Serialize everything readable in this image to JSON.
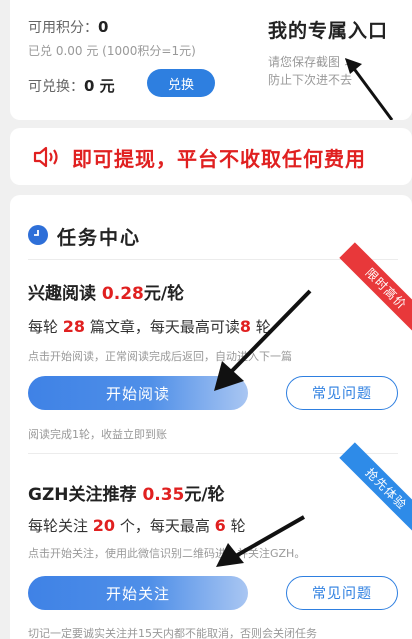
{
  "points": {
    "available_label": "可用积分：",
    "available_value": "0",
    "converted_text": "已兑 0.00 元 (1000积分=1元)",
    "exchangeable_label": "可兑换：",
    "exchangeable_value": "0 元",
    "exchange_button": "兑换"
  },
  "entry": {
    "title": "我的专属入口",
    "save_text": "请您保存截图 >",
    "save_hint": "防止下次进不去"
  },
  "notice": {
    "text": "即可提现，平台不收取任何费用"
  },
  "tasks": {
    "section_title": "任务中心",
    "items": [
      {
        "title": "兴趣阅读",
        "price": "0.28",
        "unit": "元/轮",
        "line_prefix": "每轮",
        "count": "28",
        "line_mid": "篇文章，每天最高可读",
        "max": "8",
        "line_suffix": "轮",
        "note": "点击开始阅读，正常阅读完成后返回，自动进入下一篇",
        "start_button": "开始阅读",
        "faq_button": "常见问题",
        "footer_note": "阅读完成1轮，收益立即到账",
        "ribbon": "限时高价",
        "ribbon_color": "#e8383a"
      },
      {
        "title": "GZH关注推荐",
        "price": "0.35",
        "unit": "元/轮",
        "line_prefix": "每轮关注",
        "count": "20",
        "line_mid": "个，每天最高",
        "max": "6",
        "line_suffix": "轮",
        "note": "点击开始关注，使用此微信识别二维码进入并关注GZH。",
        "start_button": "开始关注",
        "faq_button": "常见问题",
        "footer_note": "切记一定要诚实关注并15天内都不能取消，否则会关闭任务",
        "ribbon": "抢先体验",
        "ribbon_color": "#2e8be8"
      }
    ]
  },
  "colors": {
    "accent_blue": "#2e7fe0",
    "alert_red": "#e02020",
    "background": "#f0f0f0"
  },
  "icons": [
    "speaker-icon",
    "clock-icon",
    "pointer-arrow-icon"
  ]
}
